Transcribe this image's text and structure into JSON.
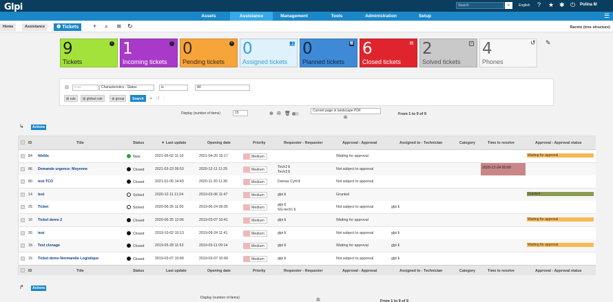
{
  "topbar": {
    "logo": "Glpi",
    "search_placeholder": "Search",
    "language": "English",
    "user": "Polina M"
  },
  "menu": [
    "Assets",
    "Assistance",
    "Management",
    "Tools",
    "Administration",
    "Setup"
  ],
  "breadcrumb": {
    "home": "Home",
    "assistance": "Assistance",
    "tickets": "Tickets",
    "entity": "Racine (tree structure)"
  },
  "tiles": [
    {
      "num": "9",
      "label": "Tickets",
      "bg": "#a3e23a",
      "fg": "#1d1d1d"
    },
    {
      "num": "1",
      "label": "Incoming tickets",
      "bg": "#a939c9",
      "fg": "#ffffff"
    },
    {
      "num": "0",
      "label": "Pending tickets",
      "bg": "#f7a43b",
      "fg": "#3a2a12"
    },
    {
      "num": "0",
      "label": "Assigned tickets",
      "bg": "#dff1fa",
      "fg": "#3aa0d4"
    },
    {
      "num": "0",
      "label": "Planned tickets",
      "bg": "#3f8ad6",
      "fg": "#0b2746"
    },
    {
      "num": "6",
      "label": "Closed tickets",
      "bg": "#e0242e",
      "fg": "#ffffff"
    },
    {
      "num": "2",
      "label": "Solved tickets",
      "bg": "#c9c9c9",
      "fg": "#555555"
    },
    {
      "num": "4",
      "label": "Phones",
      "bg": "#f7f7f7",
      "fg": "#666666"
    }
  ],
  "criteria": {
    "op": "------",
    "field": "Characteristics - Status",
    "condition": "is",
    "value": "All",
    "rule_label": "rule",
    "global_rule_label": "global rule",
    "group_label": "group",
    "search_label": "Search"
  },
  "display": {
    "label": "Display (number of items)",
    "per_page": "15",
    "export": "Current page in landscape PDF",
    "count": "From 1 to 9 of 9",
    "actions": "Actions"
  },
  "columns": [
    "ID",
    "Title",
    "Status",
    "Last update",
    "Opening date",
    "Priority",
    "Requester - Requester",
    "Approval - Approval",
    "Assigned to - Technician",
    "Category",
    "Time to resolve",
    "Approval - Approval status"
  ],
  "rows": [
    {
      "id": "84",
      "title": "fdsfds",
      "status": "New",
      "status_color": "#2ca02c",
      "status_style": "fill",
      "updated": "2021-06-02 11:10",
      "opened": "2021-04-20 15:17",
      "priority": "Medium",
      "requester": "",
      "requester2": "",
      "approval": "Waiting for approval",
      "tech": "",
      "resolve": "",
      "approval_status": "Waiting for approval",
      "approval_color": "#f7b955"
    },
    {
      "id": "86",
      "title": "Demande urgence: Moyenne",
      "status": "Closed",
      "status_color": "#111111",
      "status_style": "fill",
      "updated": "2021-03-23 09:53",
      "opened": "2020-12-11 11:25",
      "priority": "Medium",
      "requester": "Tech2 ℹ",
      "requester2": "Tech3 ℹ",
      "approval": "Not subject to approval",
      "tech": "",
      "resolve": "2020-12-24 00:00",
      "approval_status": "",
      "approval_color": ""
    },
    {
      "id": "80",
      "title": "test TCO",
      "status": "Closed",
      "status_color": "#111111",
      "status_style": "fill",
      "updated": "2021-01-05 14:43",
      "opened": "2020-11-30 11:36",
      "priority": "Medium",
      "requester": "Damas Cyril ℹ",
      "requester2": "",
      "approval": "Not subject to approval",
      "tech": "",
      "resolve": "",
      "approval_status": "",
      "approval_color": ""
    },
    {
      "id": "14",
      "title": "test",
      "status": "Solved",
      "status_color": "#111111",
      "status_style": "ring",
      "updated": "2020-12-11 11:24",
      "opened": "2019-03-06 11:47",
      "priority": "Medium",
      "requester": "glpi ℹ",
      "requester2": "",
      "approval": "Granted",
      "tech": "",
      "resolve": "",
      "approval_status": "Granted",
      "approval_color": "#8a9b4f"
    },
    {
      "id": "25",
      "title": "Ticket",
      "status": "Solved",
      "status_color": "#111111",
      "status_style": "ring",
      "updated": "2020-06-26 11:00",
      "opened": "2019-06-24 09:35",
      "priority": "Medium",
      "requester": "glpi ℹ",
      "requester2": "SG-tech1 ℹ",
      "approval": "Not subject to approval",
      "tech": "glpi ℹ",
      "resolve": "",
      "approval_status": "",
      "approval_color": ""
    },
    {
      "id": "16",
      "title": "Ticket demo 2",
      "status": "Closed",
      "status_color": "#111111",
      "status_style": "fill",
      "updated": "2020-06-25 13:06",
      "opened": "2019-03-07 10:41",
      "priority": "Medium",
      "requester": "glpi ℹ",
      "requester2": "",
      "approval": "Waiting for approval",
      "tech": "",
      "resolve": "",
      "approval_status": "Waiting for approval",
      "approval_color": "#f7b955"
    },
    {
      "id": "26",
      "title": "test",
      "status": "Closed",
      "status_color": "#111111",
      "status_style": "fill",
      "updated": "2019-10-02 10:13",
      "opened": "2019-09-24 11:41",
      "priority": "Medium",
      "requester": "glpi ℹ",
      "requester2": "",
      "approval": "Not subject to approval",
      "tech": "glpi ℹ",
      "resolve": "",
      "approval_status": "",
      "approval_color": ""
    },
    {
      "id": "18",
      "title": "Test clonage",
      "status": "Closed",
      "status_color": "#111111",
      "status_style": "fill",
      "updated": "2019-05-28 11:53",
      "opened": "2019-03-11 09:14",
      "priority": "Medium",
      "requester": "glpi ℹ",
      "requester2": "",
      "approval": "Waiting for approval",
      "tech": "glpi ℹ",
      "resolve": "",
      "approval_status": "Waiting for approval",
      "approval_color": "#f7b955"
    },
    {
      "id": "15",
      "title": "Ticket demo Normandie Logistique",
      "status": "Closed",
      "status_color": "#111111",
      "status_style": "fill",
      "updated": "2019-03-07 10:49",
      "opened": "2019-03-07 10:49",
      "priority": "Medium",
      "requester": "glpi ℹ",
      "requester2": "",
      "approval": "Not subject to approval",
      "tech": "glpi ℹ",
      "resolve": "",
      "approval_status": "",
      "approval_color": ""
    }
  ]
}
